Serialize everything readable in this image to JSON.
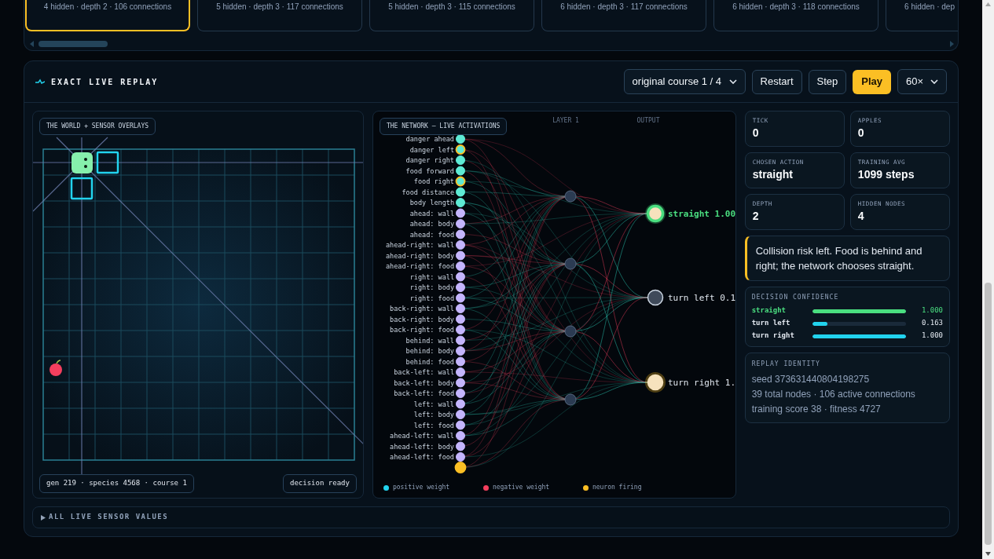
{
  "model_cards": [
    {
      "text": "4 hidden · depth 2 · 106 connections",
      "selected": true
    },
    {
      "text": "5 hidden · depth 3 · 117 connections",
      "selected": false
    },
    {
      "text": "5 hidden · depth 3 · 115 connections",
      "selected": false
    },
    {
      "text": "6 hidden · depth 3 · 117 connections",
      "selected": false
    },
    {
      "text": "6 hidden · depth 3 · 118 connections",
      "selected": false
    },
    {
      "text": "6 hidden · dep",
      "selected": false
    }
  ],
  "replay": {
    "title": "EXACT LIVE REPLAY",
    "course_select": "original course 1 / 4",
    "buttons": [
      {
        "label": "Restart",
        "kind": "plain"
      },
      {
        "label": "Step",
        "kind": "plain"
      },
      {
        "label": "Play",
        "kind": "primary"
      }
    ],
    "speed_select": "60×"
  },
  "world": {
    "title": "THE WORLD + SENSOR OVERLAYS",
    "info": "gen 219 · species 4568 · course 1",
    "status": "decision ready"
  },
  "network": {
    "title": "THE NETWORK — LIVE ACTIVATIONS",
    "layers": [
      "LAYER 1",
      "OUTPUT"
    ],
    "inputs": [
      {
        "label": "danger ahead",
        "kind": "sensor",
        "firing": false
      },
      {
        "label": "danger left",
        "kind": "sensor",
        "firing": true
      },
      {
        "label": "danger right",
        "kind": "sensor",
        "firing": false
      },
      {
        "label": "food forward",
        "kind": "sensor",
        "firing": false
      },
      {
        "label": "food right",
        "kind": "sensor",
        "firing": true
      },
      {
        "label": "food distance",
        "kind": "sensor",
        "firing": false
      },
      {
        "label": "body length",
        "kind": "sensor",
        "firing": false
      },
      {
        "label": "ahead: wall",
        "kind": "ray",
        "firing": false
      },
      {
        "label": "ahead: body",
        "kind": "ray",
        "firing": false
      },
      {
        "label": "ahead: food",
        "kind": "ray",
        "firing": false
      },
      {
        "label": "ahead-right: wall",
        "kind": "ray",
        "firing": false
      },
      {
        "label": "ahead-right: body",
        "kind": "ray",
        "firing": false
      },
      {
        "label": "ahead-right: food",
        "kind": "ray",
        "firing": false
      },
      {
        "label": "right: wall",
        "kind": "ray",
        "firing": false
      },
      {
        "label": "right: body",
        "kind": "ray",
        "firing": false
      },
      {
        "label": "right: food",
        "kind": "ray",
        "firing": false
      },
      {
        "label": "back-right: wall",
        "kind": "ray",
        "firing": false
      },
      {
        "label": "back-right: body",
        "kind": "ray",
        "firing": false
      },
      {
        "label": "back-right: food",
        "kind": "ray",
        "firing": false
      },
      {
        "label": "behind: wall",
        "kind": "ray",
        "firing": false
      },
      {
        "label": "behind: body",
        "kind": "ray",
        "firing": false
      },
      {
        "label": "behind: food",
        "kind": "ray",
        "firing": false
      },
      {
        "label": "back-left: wall",
        "kind": "ray",
        "firing": false
      },
      {
        "label": "back-left: body",
        "kind": "ray",
        "firing": false
      },
      {
        "label": "back-left: food",
        "kind": "ray",
        "firing": false
      },
      {
        "label": "left: wall",
        "kind": "ray",
        "firing": false
      },
      {
        "label": "left: body",
        "kind": "ray",
        "firing": false
      },
      {
        "label": "left: food",
        "kind": "ray",
        "firing": false
      },
      {
        "label": "ahead-left: wall",
        "kind": "ray",
        "firing": false
      },
      {
        "label": "ahead-left: body",
        "kind": "ray",
        "firing": false
      },
      {
        "label": "ahead-left: food",
        "kind": "ray",
        "firing": false
      },
      {
        "kind": "bias",
        "firing": true
      }
    ],
    "outputs": [
      {
        "label": "straight 1.00",
        "selected": true,
        "firing": true
      },
      {
        "label": "turn left 0.1",
        "selected": false,
        "firing": false
      },
      {
        "label": "turn right 1.",
        "selected": false,
        "firing": true
      }
    ],
    "legend": [
      {
        "label": "positive weight",
        "color": "#22d3ee"
      },
      {
        "label": "negative weight",
        "color": "#f43f5e"
      },
      {
        "label": "neuron firing",
        "color": "#fbbf24"
      }
    ]
  },
  "stats": [
    {
      "label": "TICK",
      "value": "0"
    },
    {
      "label": "APPLES",
      "value": "0"
    },
    {
      "label": "CHOSEN ACTION",
      "value": "straight"
    },
    {
      "label": "TRAINING AVG",
      "value": "1099 steps"
    },
    {
      "label": "DEPTH",
      "value": "2"
    },
    {
      "label": "HIDDEN NODES",
      "value": "4"
    }
  ],
  "explanation": "Collision risk left. Food is behind and right; the network chooses straight.",
  "confidence": {
    "title": "DECISION CONFIDENCE",
    "rows": [
      {
        "label": "straight",
        "level": 1,
        "reading": "1.000",
        "selected": true,
        "color": "#4ade80"
      },
      {
        "label": "turn left",
        "level": 0.163,
        "reading": "0.163",
        "selected": false,
        "color": "#22d3ee"
      },
      {
        "label": "turn right",
        "level": 1,
        "reading": "1.000",
        "selected": false,
        "color": "#22d3ee"
      }
    ]
  },
  "identity": {
    "title": "REPLAY IDENTITY",
    "lines": [
      "seed 373631440804198275",
      "39 total nodes · 106 active connections",
      "training score 38 · fitness 4727"
    ]
  },
  "sensor_values": {
    "label": "ALL LIVE SENSOR VALUES",
    "expanded": false
  }
}
